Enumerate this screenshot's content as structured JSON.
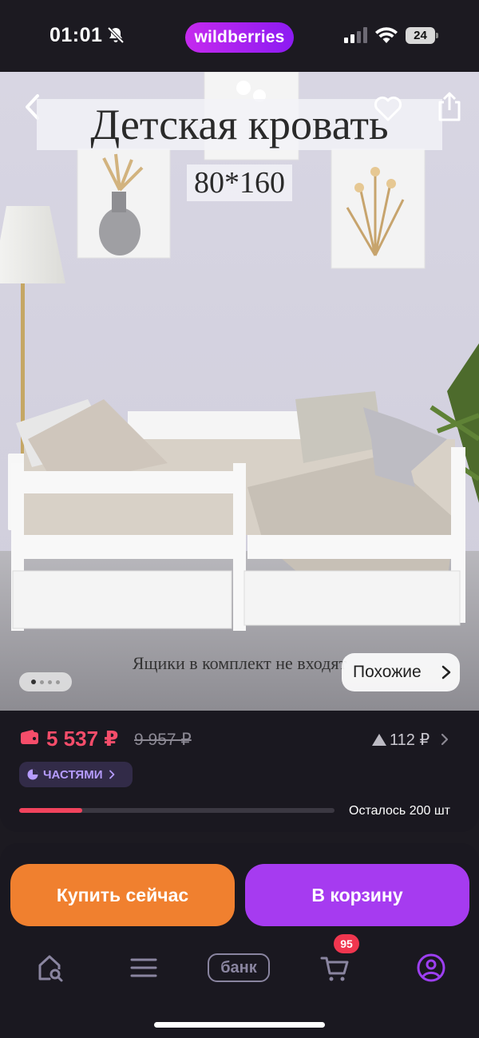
{
  "status_bar": {
    "time": "01:01",
    "brand": "wildberries",
    "battery": "24"
  },
  "product_photo": {
    "title": "Детская кровать",
    "subtitle": "80*160",
    "caption": "Ящики в комплект не входят",
    "similar_button": "Похожие",
    "photo_count": 4,
    "active_photo_index": 0
  },
  "pricing": {
    "current_price": "5 537 ₽",
    "old_price": "9 957 ₽",
    "price_rise": "112 ₽",
    "installments_label": "ЧАСТЯМИ",
    "stock_text": "Осталось 200 шт",
    "stock_fraction": 0.2
  },
  "actions": {
    "buy_now": "Купить сейчас",
    "add_to_cart": "В корзину"
  },
  "tabbar": {
    "bank_label": "банк",
    "cart_badge": "95",
    "active_tab": "profile"
  },
  "colors": {
    "background": "#1c1a21",
    "price_red": "#f64d6a",
    "buy_now_orange": "#f0802f",
    "cart_purple": "#a63bf0",
    "brand_purple": "#a822f0",
    "active_tab_purple": "#9d3ff2"
  },
  "icons": [
    "bell-muted-icon",
    "signal-icon",
    "wifi-icon",
    "battery-icon",
    "back-icon",
    "heart-icon",
    "share-icon",
    "wallet-icon",
    "triangle-up-icon",
    "chevron-right-icon",
    "pie-icon",
    "home-search-icon",
    "menu-icon",
    "cart-icon",
    "profile-icon"
  ]
}
